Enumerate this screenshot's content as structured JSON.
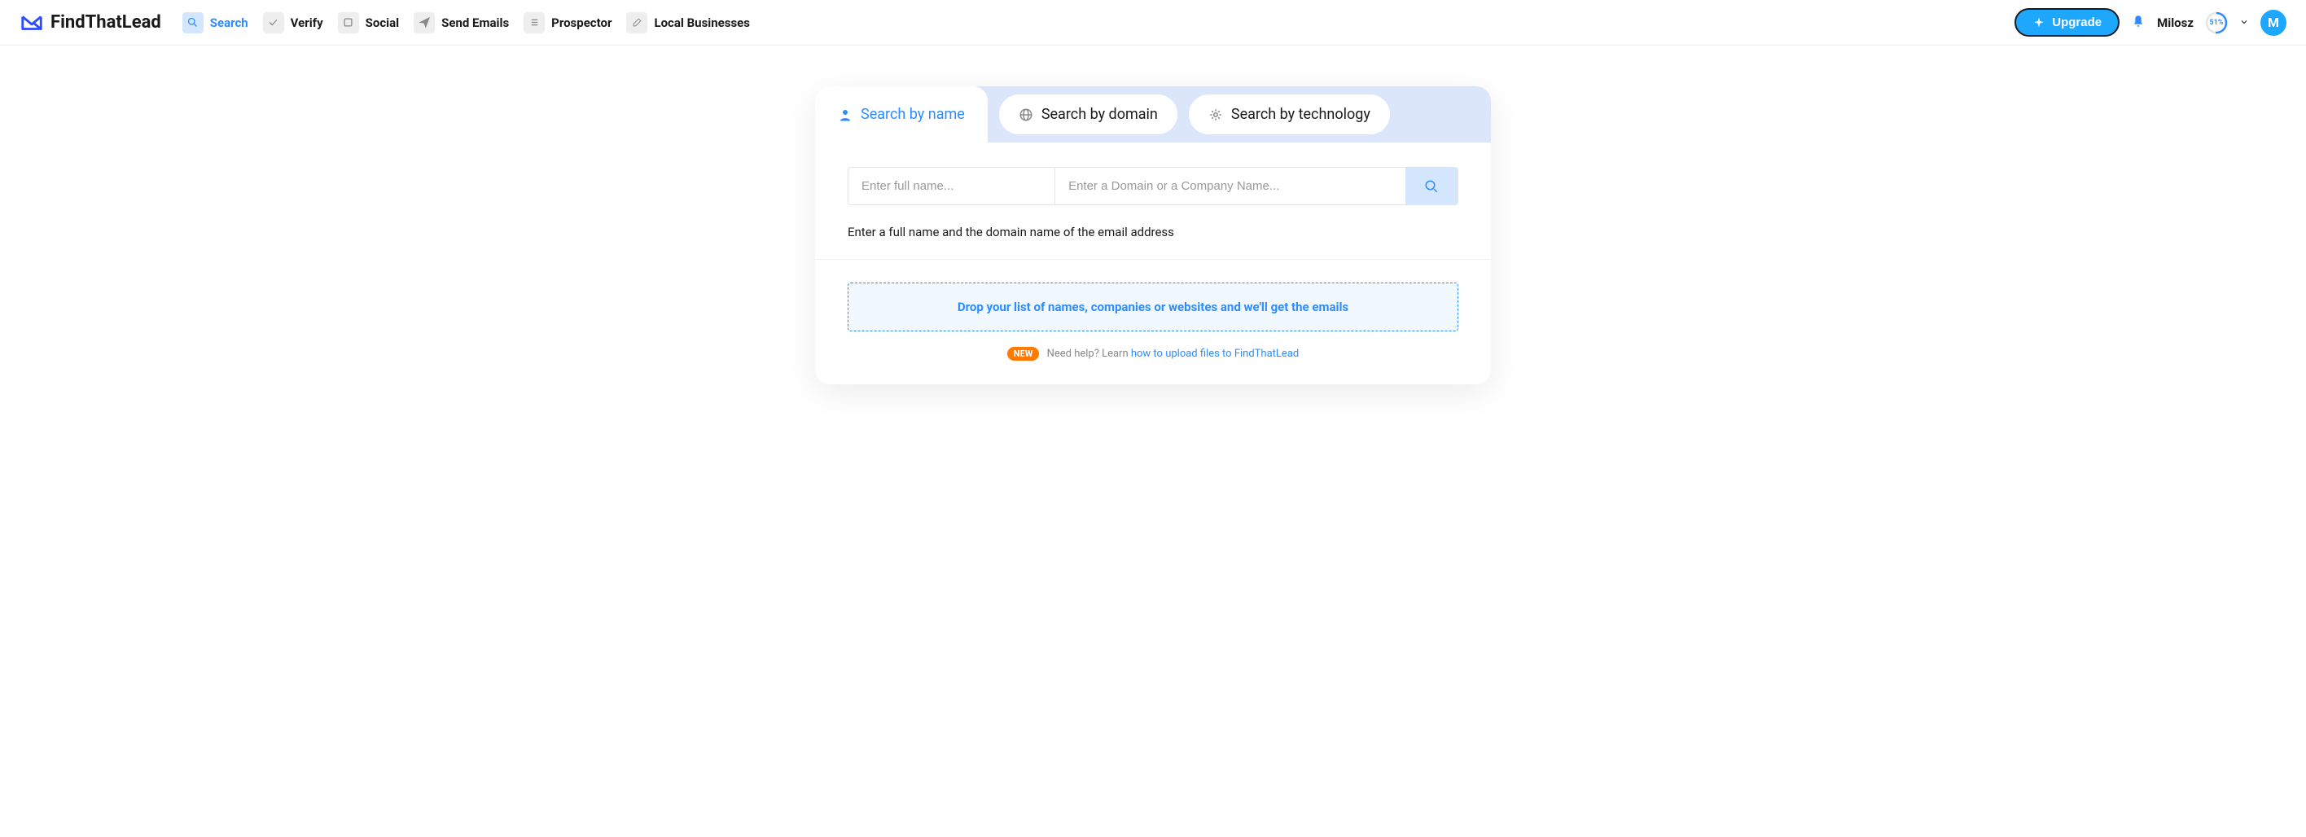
{
  "brand": "FindThatLead",
  "nav": {
    "search": "Search",
    "verify": "Verify",
    "social": "Social",
    "send_emails": "Send Emails",
    "prospector": "Prospector",
    "local_businesses": "Local Businesses"
  },
  "header": {
    "upgrade": "Upgrade",
    "username": "Milosz",
    "progress_percent": "51%",
    "avatar_initial": "M"
  },
  "tabs": {
    "by_name": "Search by name",
    "by_domain": "Search by domain",
    "by_technology": "Search by technology"
  },
  "search": {
    "name_placeholder": "Enter full name...",
    "domain_placeholder": "Enter a Domain or a Company Name...",
    "hint": "Enter a full name and the domain name of the email address"
  },
  "dropzone": "Drop your list of names, companies or websites and we'll get the emails",
  "help": {
    "new_badge": "NEW",
    "prefix": "Need help? Learn ",
    "link": "how to upload files to FindThatLead"
  }
}
